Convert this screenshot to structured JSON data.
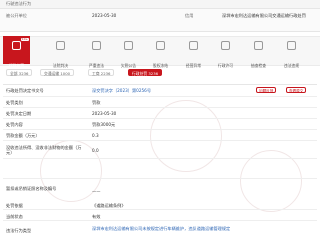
{
  "header": {
    "row1_label": "行驶违法行为",
    "row2_label": "被公开单位",
    "row2_value": "2023-05-30",
    "row2_label2": "信用",
    "row2_desc": "深圳市宏利达运输有限公司交通运输行政处罚"
  },
  "tabs": [
    {
      "label": "行政处罚",
      "badge": "10+"
    },
    {
      "label": "法院判决"
    },
    {
      "label": "严重违法"
    },
    {
      "label": "欠税公告"
    },
    {
      "label": "股权冻结"
    },
    {
      "label": "经营异常"
    },
    {
      "label": "行政许可"
    },
    {
      "label": "抽查检查"
    },
    {
      "label": "违法违规"
    }
  ],
  "filters": [
    {
      "label": "全部 3236"
    },
    {
      "label": "交通运输 1000"
    },
    {
      "label": "工商 2236"
    },
    {
      "label": "行政处罚 3236"
    }
  ],
  "detail": {
    "case_no_label": "行政处罚决定书文号",
    "case_no_value": "深交罚决字〔2023〕第0256号",
    "btn_report": "问题反馈",
    "btn_view": "查看原文",
    "category_label": "处罚类别",
    "category_value": "罚款",
    "date_label": "处罚决定日期",
    "date_value": "2023-05-30",
    "content_label": "处罚内容",
    "content_value": "罚款3000元",
    "amount_label": "罚款金额（万元）",
    "amount_value": "0.3",
    "confiscate_label": "没收违法所得、没收非法财物的金额（万元）",
    "confiscate_value": "0.0",
    "license_label": "暂扣或吊销证照名称及编号",
    "license_value": "——",
    "basis_label": "处罚依据",
    "basis_value": "《道路运输条例》",
    "status_label": "当前状态",
    "status_value": "有效",
    "facts_label": "违法行为类型",
    "facts_value": "深圳市宏利达运输有限公司未按规定进行车辆维护，违反道路运输管理规定"
  }
}
